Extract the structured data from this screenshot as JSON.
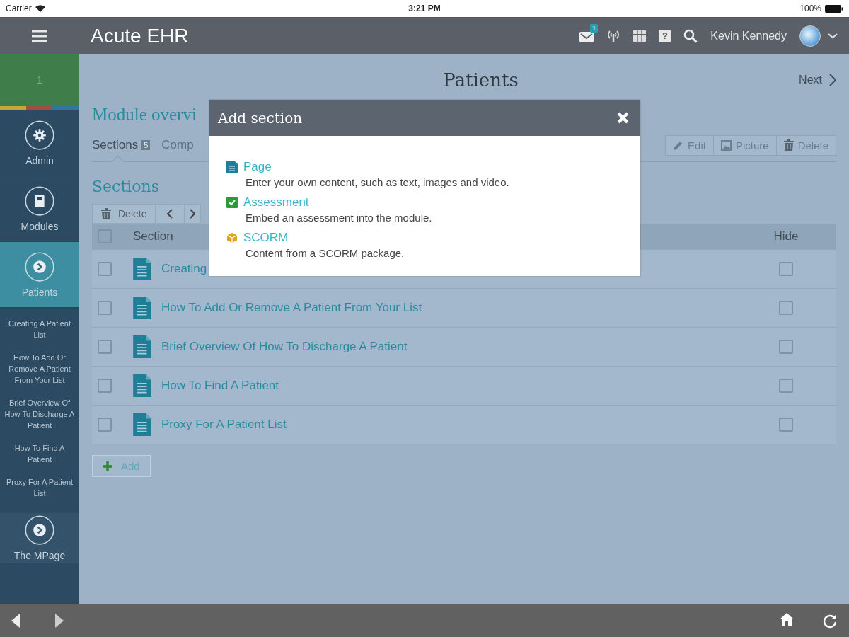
{
  "status_bar": {
    "carrier": "Carrier",
    "time": "3:21 PM",
    "battery": "100%"
  },
  "header": {
    "app_title": "Acute EHR",
    "mail_badge": "1",
    "help_label": "?",
    "user_name": "Kevin Kennedy"
  },
  "sidebar": {
    "top_badge": "1",
    "items": [
      {
        "label": "Admin",
        "kind": "gear",
        "selected": false
      },
      {
        "label": "Modules",
        "kind": "book",
        "selected": false
      },
      {
        "label": "Patients",
        "kind": "arrow",
        "selected": true,
        "children": [
          {
            "label": "Creating A Patient List"
          },
          {
            "label": "How To Add Or Remove A Patient From Your List"
          },
          {
            "label": "Brief Overview Of How To Discharge A Patient"
          },
          {
            "label": "How To Find A Patient"
          },
          {
            "label": "Proxy For A Patient List"
          }
        ]
      },
      {
        "label": "The MPage",
        "kind": "arrow",
        "selected": false
      }
    ]
  },
  "page": {
    "title": "Patients",
    "next_link": "Next",
    "module_title": "Module overvi",
    "tabs": [
      {
        "label": "Sections",
        "count": "5",
        "selected": true
      },
      {
        "label": "Comp",
        "selected": false
      }
    ],
    "actions": [
      "Edit",
      "Picture",
      "Delete"
    ],
    "sections_heading": "Sections",
    "toolbar_delete": "Delete",
    "table": {
      "columns": [
        "Section",
        "Hide"
      ],
      "header_checked": false,
      "rows": [
        {
          "title": "Creating",
          "checked": false,
          "hidden": false
        },
        {
          "title": "How To Add Or Remove A Patient From Your List",
          "checked": false,
          "hidden": false
        },
        {
          "title": "Brief Overview Of How To Discharge A Patient",
          "checked": false,
          "hidden": false
        },
        {
          "title": "How To Find A Patient",
          "checked": false,
          "hidden": false
        },
        {
          "title": "Proxy For A Patient List",
          "checked": false,
          "hidden": false
        }
      ]
    },
    "add_button": "Add"
  },
  "dialog": {
    "title": "Add section",
    "options": [
      {
        "kind": "page",
        "label": "Page",
        "description": "Enter your own content, such as text, images and video."
      },
      {
        "kind": "assessment",
        "label": "Assessment",
        "description": "Embed an assessment into the module."
      },
      {
        "kind": "scorm",
        "label": "SCORM",
        "description": "Content from a SCORM package."
      }
    ]
  }
}
